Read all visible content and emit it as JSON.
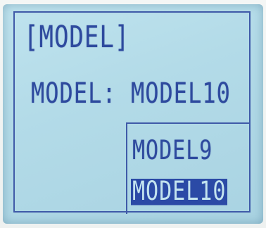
{
  "screen": {
    "title": "[MODEL]",
    "field_label": "MODEL:",
    "field_value": "MODEL10"
  },
  "dropdown": {
    "options": [
      {
        "label": "MODEL9",
        "selected": false
      },
      {
        "label": "MODEL10",
        "selected": true
      }
    ]
  },
  "colors": {
    "lcd_background": "#b6dde9",
    "lcd_text": "#2e4a9e",
    "highlight": "#2b4aa6"
  }
}
